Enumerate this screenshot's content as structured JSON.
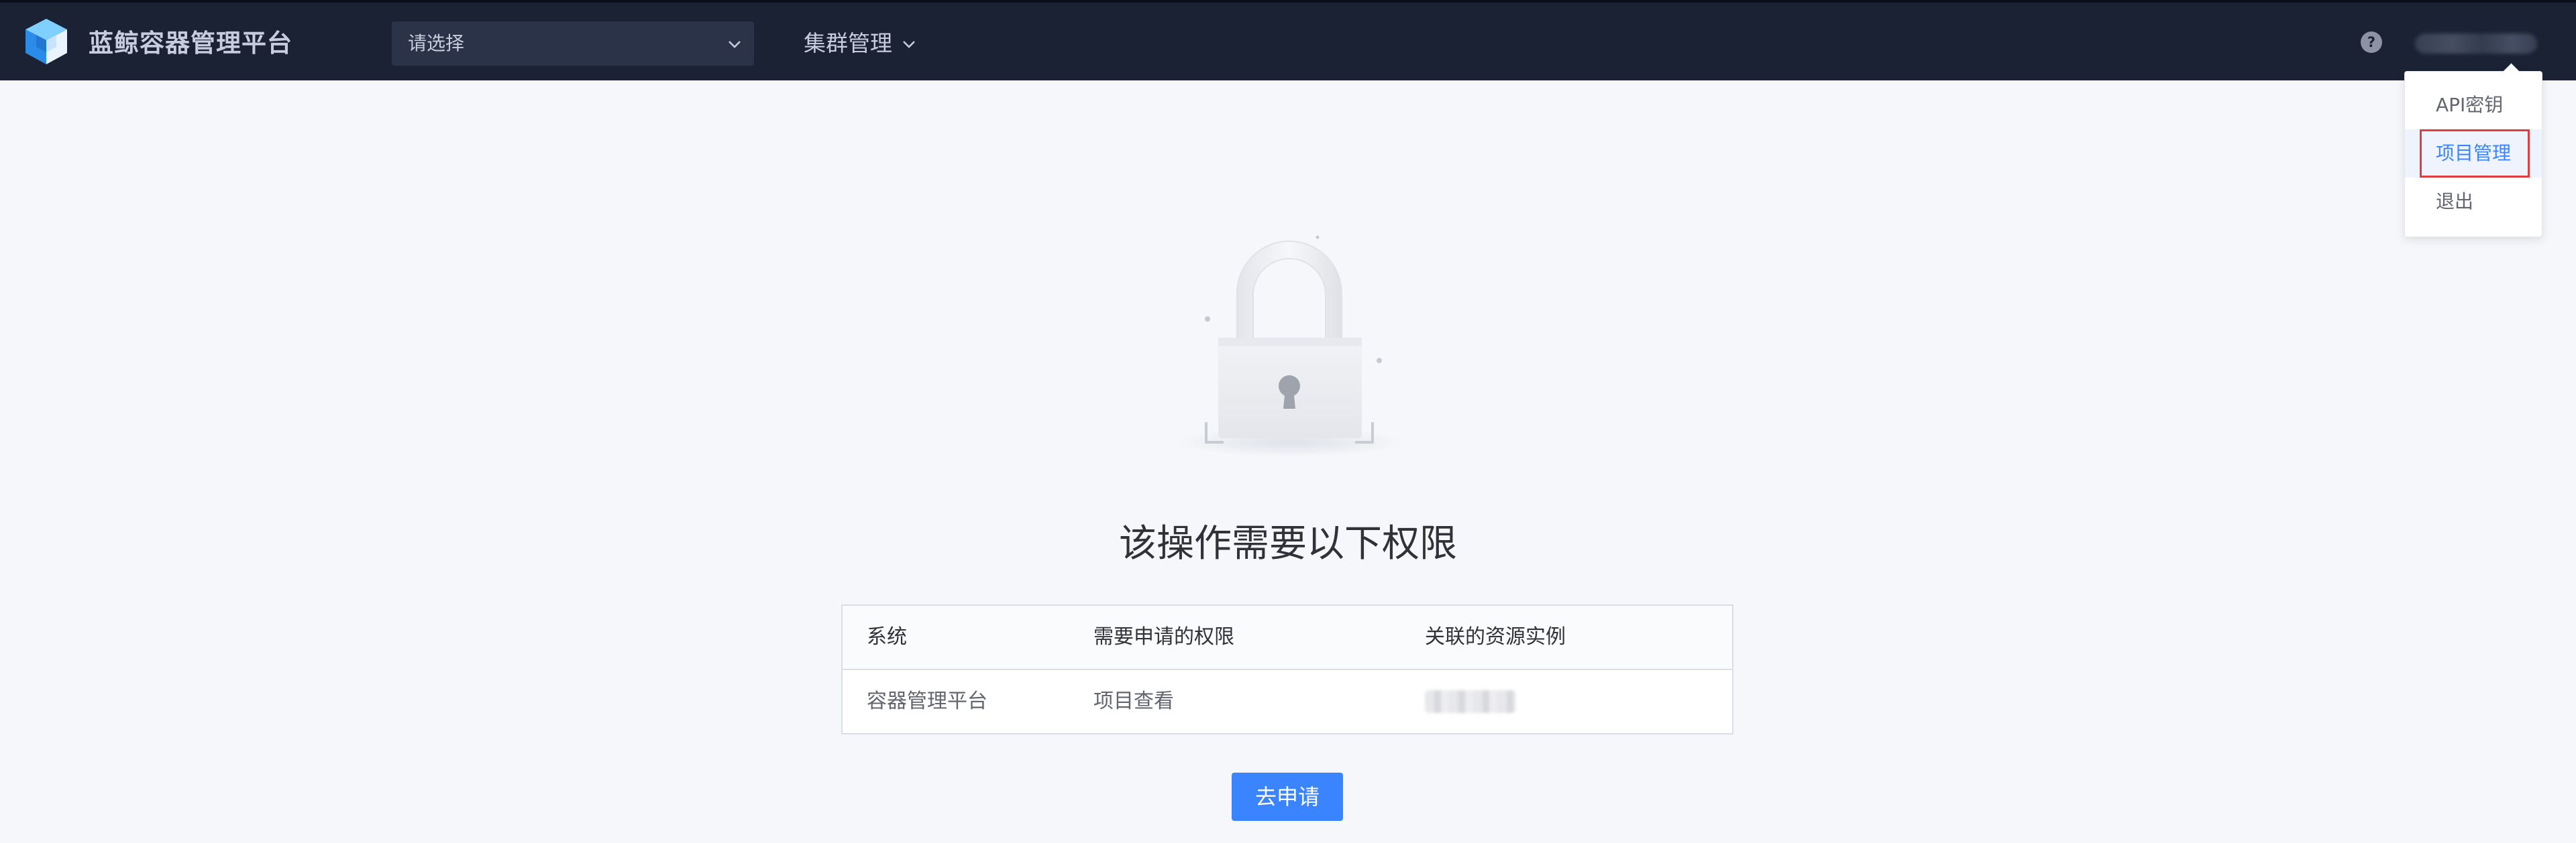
{
  "header": {
    "app_title": "蓝鲸容器管理平台",
    "project_select": {
      "placeholder": "请选择"
    },
    "nav": {
      "cluster_label": "集群管理"
    },
    "help_icon": "question-circle-icon",
    "user_icon": "user-avatar-icon"
  },
  "user_menu": {
    "items": [
      {
        "label": "API密钥",
        "active": false
      },
      {
        "label": "项目管理",
        "active": true
      },
      {
        "label": "退出",
        "active": false
      }
    ]
  },
  "permission": {
    "title": "该操作需要以下权限",
    "columns": [
      "系统",
      "需要申请的权限",
      "关联的资源实例"
    ],
    "rows": [
      {
        "system": "容器管理平台",
        "action": "项目查看",
        "resource": ""
      }
    ],
    "apply_label": "去申请"
  },
  "colors": {
    "header_bg": "#1b2234",
    "accent": "#3a84ff",
    "highlight": "#e03e3e",
    "page_bg": "#f5f7fa"
  }
}
